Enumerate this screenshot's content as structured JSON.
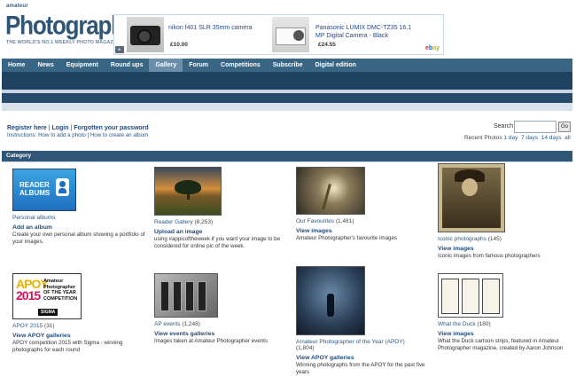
{
  "logo": {
    "amateur": "amateur",
    "photographer": "Photographer",
    "tagline": "THE WORLD'S NO.1 WEEKLY PHOTO MAGAZINE"
  },
  "ad": {
    "product1_title": "nikon f401 SLR 35mm camera",
    "product1_price": "£10.00",
    "product2_title": "Panasonic LUMIX DMC-TZ35 16.1 MP Digital Camera - Black",
    "product2_price": "£24.55",
    "ebay_e": "e",
    "ebay_b": "b",
    "ebay_a": "a",
    "ebay_y": "y"
  },
  "nav": {
    "items": [
      "Home",
      "News",
      "Equipment",
      "Round ups",
      "Gallery",
      "Forum",
      "Competitions",
      "Subscribe",
      "Digital edition"
    ],
    "active": "Gallery"
  },
  "account": {
    "register": "Register here",
    "login": "Login",
    "forgot": "Forgotten your password",
    "sep": "|",
    "instructions_label": "Instructions:",
    "how_add": "How to add a photo",
    "how_create": "How to create an album"
  },
  "search": {
    "label": "Search",
    "placeholder": "",
    "button": "Go"
  },
  "recent": {
    "label": "Recent Photos",
    "d1": "1 day",
    "d7": "7 days",
    "d14": "14 days",
    "all": "all"
  },
  "category_label": "Category",
  "reader_albums_text": "READER ALBUMS",
  "apoy2015_thumb": {
    "big1": "APOY",
    "big2": "2015",
    "txt": "Amateur Photographer OF THE YEAR COMPETITION",
    "sigma": "SIGMA"
  },
  "cards": [
    {
      "name": "Personal albums",
      "count": "",
      "action": "Add an album",
      "desc": "Create your own personal album showing a portfolio of your images."
    },
    {
      "name": "Reader Gallery",
      "count": "(8,253)",
      "action": "Upload an image",
      "desc": "using #appicoftheweek if you want your image to be considered for online pic of the week."
    },
    {
      "name": "Our Favourites",
      "count": "(1,481)",
      "action": "View images",
      "desc": "Amateur Photographer's favourite images"
    },
    {
      "name": "Iconic photographs",
      "count": "(145)",
      "action": "View images",
      "desc": "Iconic images from famous photographers"
    },
    {
      "name": "APOY 2015",
      "count": "(31)",
      "action": "View APOY galleries",
      "desc": "APOY competition 2015 with Sigma - winning photographs for each round"
    },
    {
      "name": "AP events",
      "count": "(1,248)",
      "action": "View events galleries",
      "desc": "Images taken at Amateur Photographer events"
    },
    {
      "name": "Amateur Photographer of the Year (APOY)",
      "count": "(1,804)",
      "action": "View APOY galleries",
      "desc": "Winning photographs from the APOY for the past five years"
    },
    {
      "name": "What the Duck",
      "count": "(180)",
      "action": "View images",
      "desc": "What the Duck cartoon strips, featured in Amateur Photographer magazine, created by Aaron Johnson"
    }
  ],
  "colors": {
    "nav_bg": "#3a6685",
    "nav_active": "#6b8eab",
    "link": "#2a5a86",
    "category_bar": "#2f5677"
  }
}
